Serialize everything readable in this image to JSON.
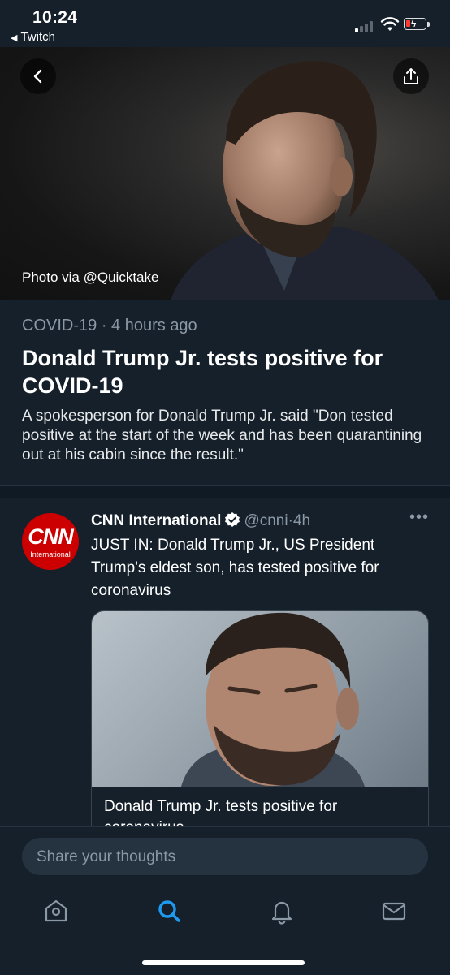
{
  "status_bar": {
    "time": "10:24",
    "back_app": "Twitch",
    "battery_color": "#ff3b30"
  },
  "hero": {
    "credit": "Photo via @Quicktake",
    "back_icon": "chevron-left-icon",
    "share_icon": "share-icon"
  },
  "article": {
    "topic": "COVID-19",
    "separator": "·",
    "age": "4 hours ago",
    "headline": "Donald Trump Jr. tests positive for COVID-19",
    "summary": "A spokesperson for Donald Trump Jr. said \"Don tested positive at the start of the week and has been quarantining out at his cabin since the result.\""
  },
  "tweet": {
    "avatar_logo": "CNN",
    "avatar_subtext": "International",
    "name": "CNN International",
    "handle": "@cnni",
    "separator": "·",
    "time": "4h",
    "more": "•••",
    "text": "JUST IN: Donald Trump Jr., US President Trump's eldest son, has tested positive for coronavirus",
    "card_title": "Donald Trump Jr. tests positive for coronavirus"
  },
  "composer": {
    "placeholder": "Share your thoughts"
  },
  "tabbar": {
    "items": [
      {
        "icon": "home-icon",
        "active": false
      },
      {
        "icon": "search-icon",
        "active": true
      },
      {
        "icon": "bell-icon",
        "active": false
      },
      {
        "icon": "mail-icon",
        "active": false
      }
    ],
    "active_color": "#1d9bf0",
    "inactive_color": "#8b98a5"
  },
  "colors": {
    "background": "#15202b",
    "secondary_text": "#8b98a5",
    "accent": "#1d9bf0",
    "cnn_red": "#cc0000"
  }
}
